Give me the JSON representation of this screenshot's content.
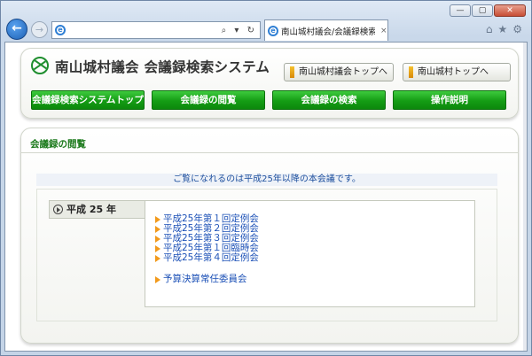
{
  "browser": {
    "tab_title": "南山城村議会/会議録検索...",
    "address": "",
    "addr_controls": "⌕ ▾ ↻",
    "tab_close": "×",
    "win_min": "—",
    "win_max": "▢",
    "win_close": "✕",
    "back_glyph": "←",
    "fwd_glyph": "→",
    "home_icon": "⌂",
    "favorites_icon": "★",
    "settings_icon": "⚙"
  },
  "header": {
    "site_title": "南山城村議会 会議録検索システム",
    "links": [
      "南山城村議会トップへ",
      "南山城村トップへ"
    ],
    "nav": [
      "会議録検索システムトップ",
      "会議録の閲覧",
      "会議録の検索",
      "操作説明"
    ]
  },
  "main": {
    "section_title": "会議録の閲覧",
    "notice": "ご覧になれるのは平成25年以降の本会議です。",
    "year": "平成 25 年",
    "meetings": [
      "平成25年第１回定例会",
      "平成25年第２回定例会",
      "平成25年第３回定例会",
      "平成25年第１回臨時会",
      "平成25年第４回定例会"
    ],
    "committee": "予算決算常任委員会"
  }
}
